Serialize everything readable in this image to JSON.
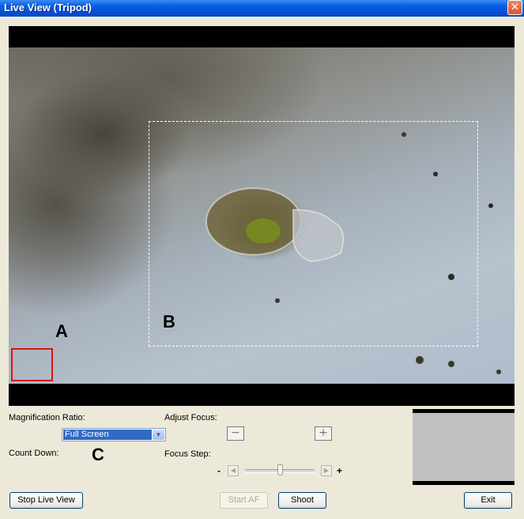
{
  "window": {
    "title": "Live View (Tripod)",
    "close_glyph": "✕"
  },
  "view": {
    "label_a": "A",
    "label_b": "B"
  },
  "controls": {
    "magnification_label": "Magnification Ratio:",
    "magnification_value": "Full Screen",
    "countdown_label": "Count Down:",
    "label_c": "C",
    "adjust_focus_label": "Adjust Focus:",
    "focus_minus": "−",
    "focus_plus": "+",
    "focus_step_label": "Focus Step:",
    "step_minus_sign": "-",
    "step_plus_sign": "+",
    "step_left_glyph": "◀",
    "step_right_glyph": "▶",
    "dropdown_glyph": "▼"
  },
  "buttons": {
    "stop_live_view": "Stop Live View",
    "start_af": "Start AF",
    "shoot": "Shoot",
    "exit": "Exit"
  }
}
